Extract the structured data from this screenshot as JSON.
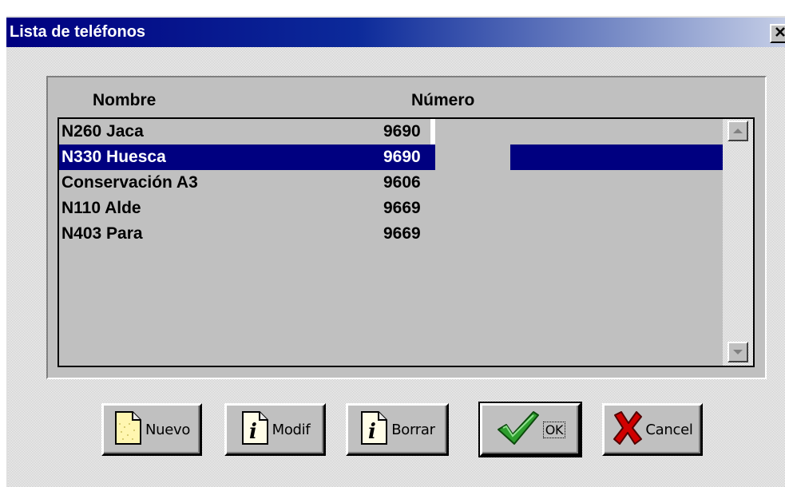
{
  "window": {
    "title": "Lista de teléfonos",
    "close_glyph": "✕"
  },
  "list": {
    "headers": {
      "name": "Nombre",
      "number": "Número"
    },
    "selected_index": 1,
    "rows": [
      {
        "name": "N260 Jaca",
        "number": "9690"
      },
      {
        "name": "N330 Huesca",
        "number": "9690"
      },
      {
        "name": "Conservación A3",
        "number": "9606"
      },
      {
        "name": "N110 Alde",
        "number": "9669"
      },
      {
        "name": "N403 Para",
        "number": "9669"
      }
    ]
  },
  "buttons": {
    "nuevo": {
      "label": "Nuevo",
      "icon": "new-document-icon"
    },
    "modif": {
      "label": "Modif",
      "icon": "info-document-icon"
    },
    "borrar": {
      "label": "Borrar",
      "icon": "info-document-icon"
    },
    "ok": {
      "label": "OK",
      "icon": "checkmark-icon"
    },
    "cancel": {
      "label": "Cancel",
      "icon": "red-x-icon"
    }
  },
  "colors": {
    "titlebar_start": "#000080",
    "selection": "#000080",
    "face": "#c0c0c0",
    "check_green": "#2e9e2e",
    "cancel_red": "#d00000"
  }
}
